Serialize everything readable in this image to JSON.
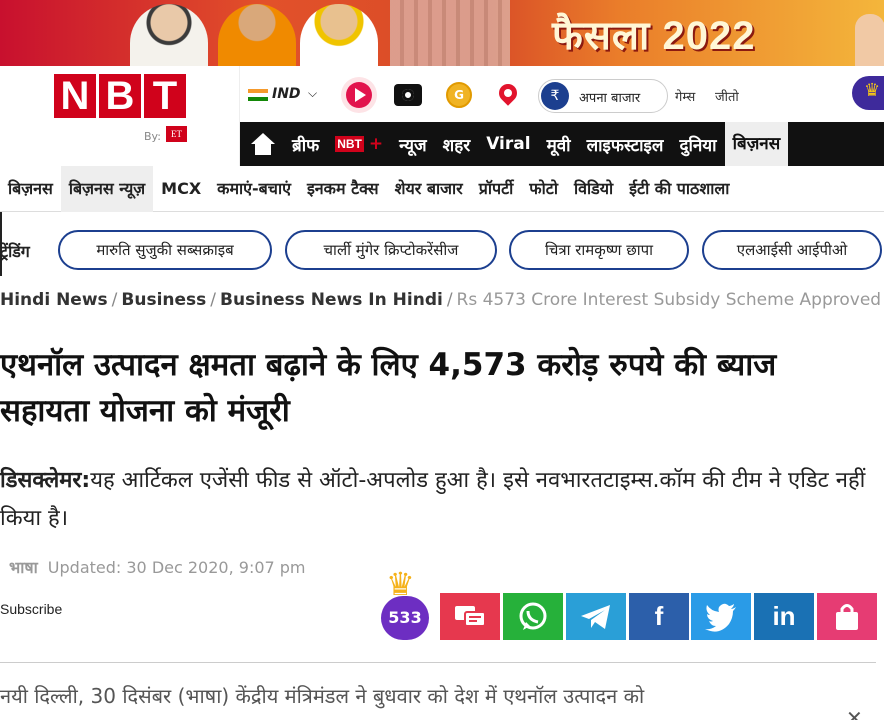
{
  "banner": {
    "title": "फैसला 2022"
  },
  "logo": {
    "letters": [
      "N",
      "B",
      "T"
    ],
    "by": "By:",
    "partner": "ET"
  },
  "topbar": {
    "edition": "IND",
    "bazar_label": "अपना बाजार",
    "games": "गेम्स",
    "jeeto": "जीतो",
    "coin_symbol": "G",
    "rupee_symbol": "₹"
  },
  "nav_main": {
    "items": [
      "ब्रीफ",
      "NBT",
      "न्यूज",
      "शहर",
      "Viral",
      "मूवी",
      "लाइफस्टाइल",
      "दुनिया",
      "बिज़नस"
    ]
  },
  "nav_sub": {
    "items": [
      "बिज़नस",
      "बिज़नस न्यूज़",
      "MCX",
      "कमाएं-बचाएं",
      "इनकम टैक्स",
      "शेयर बाजार",
      "प्रॉपर्टी",
      "फोटो",
      "विडियो",
      "ईटी की पाठशाला"
    ]
  },
  "trending": {
    "label": "ट्रेंडिंग",
    "chips": [
      "मारुति सुजुकी सब्सक्राइब",
      "चार्ली मुंगेर क्रिप्टोकरेंसीज",
      "चित्रा रामकृष्ण छापा",
      "एलआईसी आईपीओ"
    ]
  },
  "breadcrumb": {
    "items": [
      "Hindi News",
      "Business",
      "Business News In Hindi"
    ],
    "current": "Rs 4573 Crore Interest Subsidy Scheme Approved"
  },
  "article": {
    "headline": "एथनॉल उत्पादन क्षमता बढ़ाने के लिए 4,573 करोड़ रुपये की ब्याज सहायता योजना को मंजूरी",
    "disclaimer_label": "डिसक्लेमर:",
    "disclaimer_text": "यह आर्टिकल एजेंसी फीड से ऑटो-अपलोड हुआ है। इसे नवभारतटाइम्स.कॉम की टीम ने एडिट नहीं किया है।",
    "source": "भाषा",
    "updated": "Updated: 30 Dec 2020, 9:07 pm",
    "body_first_line": "नयी दिल्ली, 30 दिसंबर (भाषा) केंद्रीय मंत्रिमंडल ने बुधवार को देश में एथनॉल उत्पादन को"
  },
  "social": {
    "subscribe": "Subscribe",
    "badge_count": "533",
    "buttons": [
      "comment-icon",
      "whatsapp-icon",
      "telegram-icon",
      "facebook-icon",
      "twitter-icon",
      "linkedin-icon",
      "shopping-bag-icon"
    ]
  }
}
